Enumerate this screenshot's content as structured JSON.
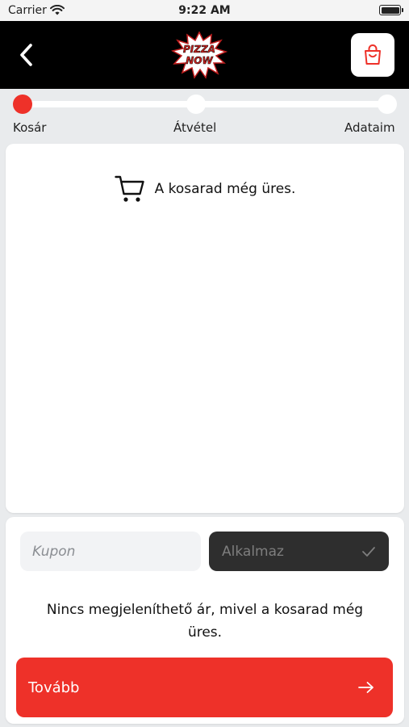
{
  "status_bar": {
    "carrier": "Carrier",
    "time": "9:22 AM"
  },
  "header": {
    "logo_line1": "PIZZA",
    "logo_line2": "NOW",
    "back_icon": "chevron-left-icon",
    "cart_icon": "shopping-bag-icon"
  },
  "steps": {
    "current": 0,
    "labels": [
      "Kosár",
      "Átvétel",
      "Adataim"
    ]
  },
  "cart": {
    "empty_icon": "shopping-cart-icon",
    "empty_message": "A kosarad még üres."
  },
  "coupon": {
    "placeholder": "Kupon",
    "apply_label": "Alkalmaz",
    "apply_icon": "check-icon"
  },
  "summary": {
    "notice": "Nincs megjeleníthető ár, mivel a kosarad még üres."
  },
  "next_button": {
    "label": "Tovább",
    "icon": "arrow-right-icon"
  },
  "colors": {
    "accent": "#ee3129",
    "header_bg": "#000000",
    "page_bg": "#e9ebed",
    "apply_bg": "#2e2e2e"
  }
}
